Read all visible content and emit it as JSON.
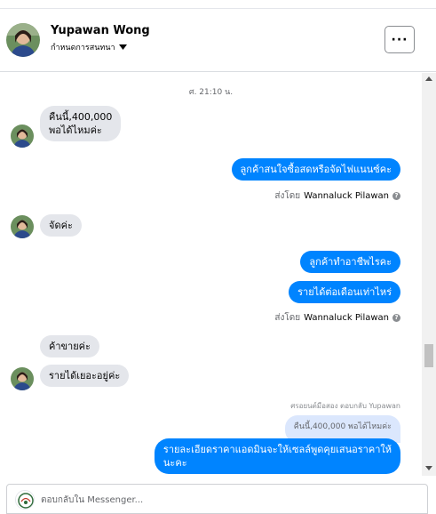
{
  "header": {
    "name": "Yupawan Wong",
    "subtitle": "กำหนดการสนทนา",
    "more_label": "···"
  },
  "thread": {
    "timestamp": "ศ. 21:10 น.",
    "messages": [
      {
        "dir": "in",
        "lines": [
          "คืนนี้,400,000",
          "พอได้ไหมค่ะ"
        ]
      },
      {
        "dir": "out",
        "text": "ลูกค้าสนใจซื้อสดหรือจัดไฟแนนซ์คะ"
      },
      {
        "dir": "in",
        "text": "จัดค่ะ"
      },
      {
        "dir": "out",
        "text": "ลูกค้าทำอาชีพไรคะ"
      },
      {
        "dir": "out",
        "text": "รายได้ต่อเดือนเท่าไหร่"
      },
      {
        "dir": "in",
        "text": "ค้าขายค่ะ"
      },
      {
        "dir": "in",
        "text": "รายได้เยอะอยู่ค่ะ"
      },
      {
        "dir": "out",
        "lines": [
          "รายละเอียดราคาแอดมินจะให้เซลล์พูดคุยเสนอราคาให้",
          "นะคะ"
        ]
      }
    ],
    "sent_by_1": {
      "label": "ส่งโดย",
      "who": "Wannaluck Pilawan"
    },
    "sent_by_2": {
      "label": "ส่งโดย",
      "who": "Wannaluck Pilawan"
    },
    "reply_label": "ศรอยนต์มือสอง ตอบกลับ Yupawan",
    "reply_quote": "คืนนี้,400,000 พอได้ไหมค่ะ"
  },
  "composer": {
    "placeholder": "ตอบกลับใน Messenger..."
  },
  "colors": {
    "outgoing_bubble": "#0084ff",
    "incoming_bubble": "#e4e6eb",
    "reply_quote_bg": "#dbe7fd"
  },
  "icons": {
    "more": "ellipsis-icon",
    "dropdown": "caret-down-icon",
    "info": "info-icon"
  }
}
